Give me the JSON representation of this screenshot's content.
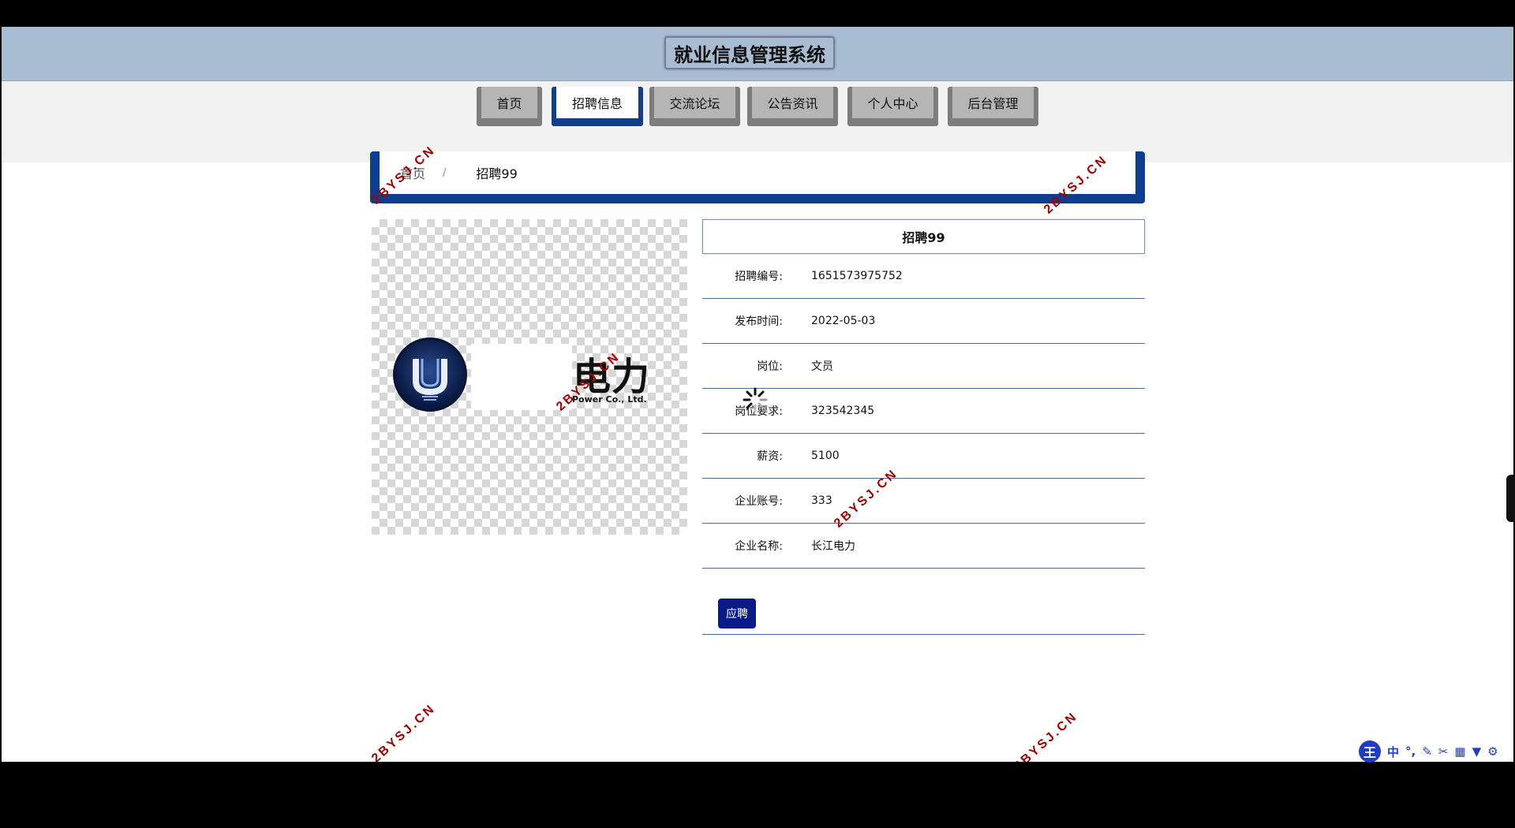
{
  "header": {
    "site_title": "就业信息管理系统"
  },
  "nav": {
    "items": [
      {
        "label": "首页",
        "active": false
      },
      {
        "label": "招聘信息",
        "active": true
      },
      {
        "label": "交流论坛",
        "active": false
      },
      {
        "label": "公告资讯",
        "active": false
      },
      {
        "label": "个人中心",
        "active": false
      },
      {
        "label": "后台管理",
        "active": false
      }
    ]
  },
  "breadcrumb": {
    "home": "首页",
    "separator": "/",
    "current": "招聘99"
  },
  "image": {
    "logo_text": "电力",
    "logo_sub": "Power Co., Ltd."
  },
  "detail": {
    "title": "招聘99",
    "fields": [
      {
        "label": "招聘编号:",
        "value": "1651573975752"
      },
      {
        "label": "发布时间:",
        "value": "2022-05-03"
      },
      {
        "label": "岗位:",
        "value": "文员"
      },
      {
        "label": "岗位要求:",
        "value": "323542345"
      },
      {
        "label": "薪资:",
        "value": "5100"
      },
      {
        "label": "企业账号:",
        "value": "333"
      },
      {
        "label": "企业名称:",
        "value": "长江电力"
      }
    ],
    "apply_label": "应聘"
  },
  "watermark": {
    "text": "2BYSJ.CN"
  },
  "ime_toolbar": {
    "logo": "王",
    "mode": "中",
    "icons": [
      "dot-icon",
      "pen-icon",
      "scissors-icon",
      "keyboard-icon",
      "shirt-icon",
      "gear-icon"
    ]
  },
  "colors": {
    "header_bg": "#a9bdd2",
    "accent_blue": "#0d3d8f",
    "apply_button": "#0b1a86",
    "watermark": "#a50000"
  }
}
